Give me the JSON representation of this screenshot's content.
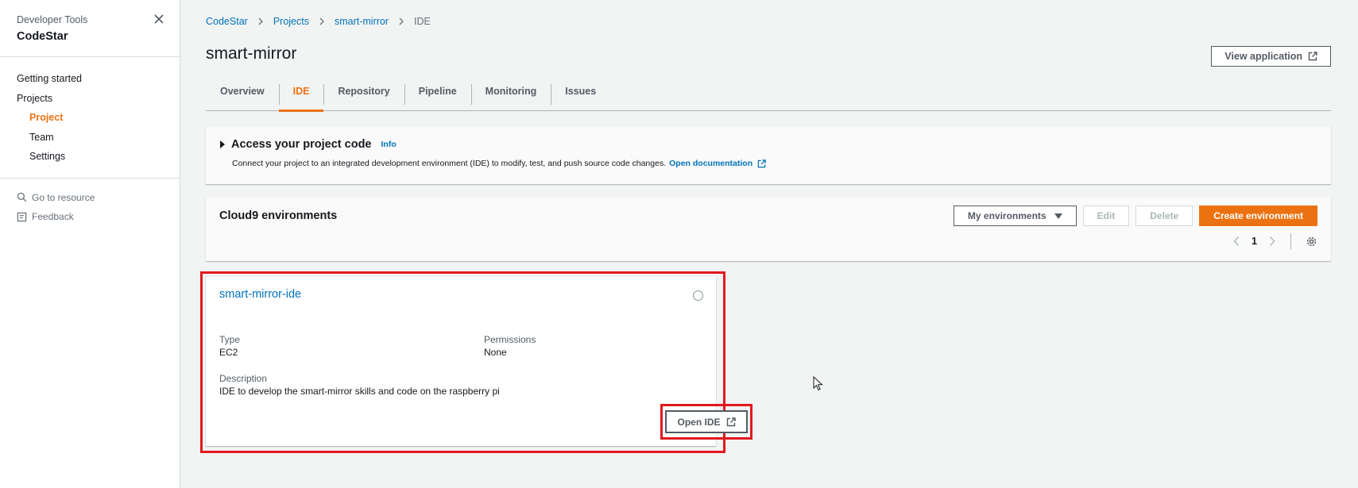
{
  "sidebar": {
    "subtitle": "Developer Tools",
    "title": "CodeStar",
    "nav": [
      {
        "label": "Getting started"
      },
      {
        "label": "Projects"
      },
      {
        "label": "Project"
      },
      {
        "label": "Team"
      },
      {
        "label": "Settings"
      }
    ],
    "links": [
      {
        "label": "Go to resource",
        "icon": "search-icon"
      },
      {
        "label": "Feedback",
        "icon": "feedback-icon"
      }
    ]
  },
  "breadcrumb": [
    "CodeStar",
    "Projects",
    "smart-mirror",
    "IDE"
  ],
  "page": {
    "title": "smart-mirror",
    "view_application": "View application"
  },
  "tabs": [
    "Overview",
    "IDE",
    "Repository",
    "Pipeline",
    "Monitoring",
    "Issues"
  ],
  "access": {
    "title": "Access your project code",
    "info": "Info",
    "description": "Connect your project to an integrated development environment (IDE) to modify, test, and push source code changes.",
    "doc_link": "Open documentation"
  },
  "cloud9": {
    "title": "Cloud9 environments",
    "filter": "My environments",
    "edit": "Edit",
    "delete": "Delete",
    "create": "Create environment",
    "page": "1"
  },
  "environment": {
    "name": "smart-mirror-ide",
    "type_label": "Type",
    "type_value": "EC2",
    "permissions_label": "Permissions",
    "permissions_value": "None",
    "description_label": "Description",
    "description_value": "IDE to develop the smart-mirror skills and code on the raspberry pi",
    "open_ide": "Open IDE"
  },
  "colors": {
    "accent": "#ec7211",
    "link": "#0073bb",
    "highlight": "#e0191f"
  }
}
